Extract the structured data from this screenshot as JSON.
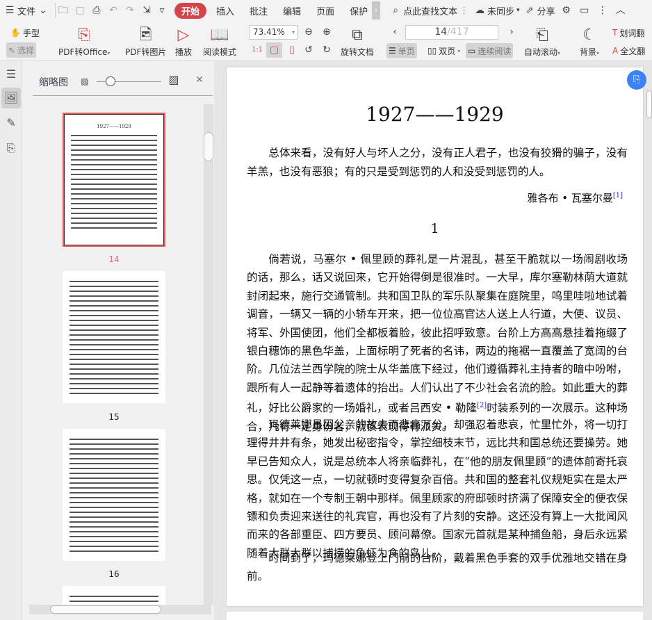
{
  "topbar": {
    "file": "文件",
    "tabs": [
      "开始",
      "插入",
      "批注",
      "编辑",
      "页面",
      "保护"
    ],
    "search_placeholder": "点此查找文本",
    "sync": "未同步",
    "share": "分享"
  },
  "ribbon": {
    "hand": "手型",
    "select": "选择",
    "pdf_office": "PDF转Office",
    "pdf_image": "PDF转图片",
    "play": "播放",
    "read_mode": "阅读模式",
    "zoom": "73.41%",
    "rotate": "旋转文档",
    "page_current": "14",
    "page_total": "/417",
    "single": "单页",
    "double": "双页",
    "continuous": "连续阅读",
    "auto_scroll": "自动滚动",
    "background": "背景",
    "word_translate": "划词翻",
    "full_translate": "全文翻"
  },
  "panel": {
    "title": "缩略图",
    "thumb_labels": [
      "14",
      "15",
      "16"
    ],
    "thumb_title": "1927——1929"
  },
  "document": {
    "title": "1927——1929",
    "epigraph": "总体来看，没有好人与坏人之分，没有正人君子，也没有狡猾的骗子，没有羊羔，也没有恶狼；有的只是受到惩罚的人和没受到惩罚的人。",
    "attribution": "雅各布 • 瓦塞尔曼",
    "fn1": "[1]",
    "chapter": "1",
    "p1a": "倘若说，马塞尔 • 佩里顾的葬礼是一片混乱，甚至干脆就以一场闹剧收场的话，那么，话又说回来，它开始得倒是很准时。一大早，库尔塞勒林荫大道就封闭起来，施行交通管制。共和国卫队的军乐队聚集在庭院里，呜里哇啦地试着调音，一辆又一辆的小轿车开来，把一位位高官达人送上人行道，大使、议员、将军、外国使团，他们全都板着脸，彼此招呼致意。台阶上方高高悬挂着拖缀了银白穗饰的黑色华盖，上面标明了死者的名讳，两边的拖裾一直覆盖了宽阔的台阶。几位法兰西学院的院士从华盖底下经过，他们遵循葬礼主持者的暗中吩咐，跟所有人一起静等着遗体的抬出。人们认出了不少社会名流的脸。如此重大的葬礼，好比公爵家的一场婚礼，或者吕西安 • 勒隆",
    "fn2": "[2]",
    "p1b": "时装系列的一次展示。这种场合，凡有一定身份者，就该表现得有派头。",
    "p2": "玛德莱娜虽因父亲的故去而悲痛万分，却强忍着悲哀，忙里忙外，将一切打理得井井有条，她发出秘密指令，掌控细枝末节，远比共和国总统还要操劳。她早已告知众人，说是总统本人将亲临葬礼，在“他的朋友佩里顾”的遗体前寄托哀思。仅凭这一点，一切就顿时变得复杂百倍。共和国的整套礼仪规矩实在是太严格，就如在一个专制王朝中那样。佩里顾家的府邸顿时挤满了保障安全的便衣保镖和负责迎来送往的礼宾官，再也没有了片刻的安静。这还没有算上一大批闻风而来的各部重臣、四方要员、顾问幕僚。国家元首就是某种捕鱼船，身后永远紧随着大群大群以捕捞的鱼虾为食的鸟儿。",
    "p3": "时间到了，玛德莱娜登上门前的台阶，戴着黑色手套的双手优雅地交错在身前。"
  },
  "colors": {
    "accent": "#d2464b",
    "thumb_selected": "#e05a5a",
    "float_button": "#3b82f6"
  }
}
